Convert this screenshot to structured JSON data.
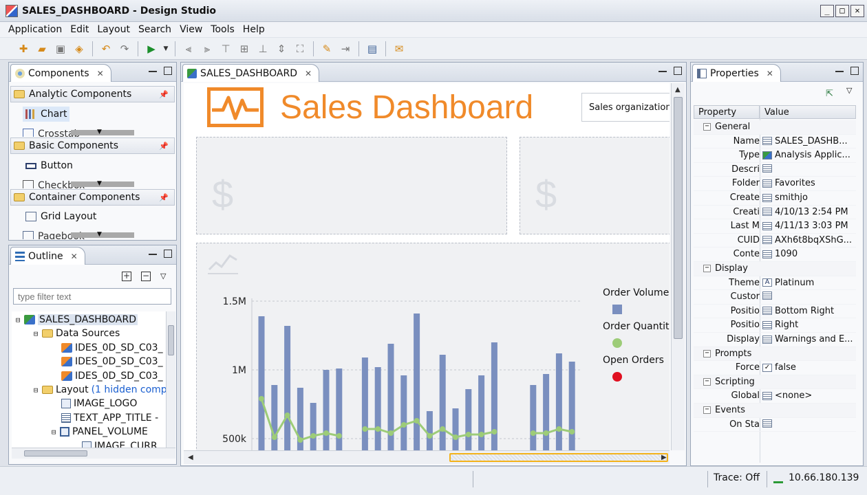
{
  "window": {
    "title": "SALES_DASHBOARD - Design Studio",
    "controls": [
      "_",
      "□",
      "✕"
    ]
  },
  "menu": [
    "Application",
    "Edit",
    "Layout",
    "Search",
    "View",
    "Tools",
    "Help"
  ],
  "components": {
    "tab_label": "Components",
    "sections": [
      {
        "label": "Analytic Components",
        "items": [
          {
            "label": "Chart",
            "selected": true
          }
        ],
        "clipped": "Crosstab"
      },
      {
        "label": "Basic Components",
        "items": [
          {
            "label": "Button"
          }
        ],
        "clipped": "Checkbox"
      },
      {
        "label": "Container Components",
        "items": [
          {
            "label": "Grid Layout"
          }
        ],
        "clipped": "Pagebook"
      }
    ]
  },
  "outline": {
    "tab_label": "Outline",
    "filter_placeholder": "type filter text",
    "tree": {
      "root": "SALES_DASHBOARD",
      "data_sources_label": "Data Sources",
      "data_sources": [
        "IDES_0D_SD_C03_",
        "IDES_0D_SD_C03_",
        "IDES_0D_SD_C03_"
      ],
      "layout_label": "Layout",
      "layout_hidden": "(1 hidden comp",
      "layout_items": [
        "IMAGE_LOGO",
        "TEXT_APP_TITLE -",
        "PANEL_VOLUME",
        "IMAGE_CURR"
      ]
    }
  },
  "editor": {
    "tab_label": "SALES_DASHBOARD",
    "dashboard_title": "Sales Dashboard",
    "sales_org_label": "Sales organization",
    "currency_symbol": "$",
    "legend": [
      {
        "label": "Order Volume",
        "color": "#7a8fbf",
        "shape": "square"
      },
      {
        "label": "Order Quantity",
        "color": "#9dcc78",
        "shape": "circle"
      },
      {
        "label": "Open Orders",
        "color": "#e01020",
        "shape": "circle"
      }
    ]
  },
  "chart_data": {
    "type": "bar",
    "ylim": [
      0,
      1500000
    ],
    "y_ticks": [
      {
        "value": 1500000,
        "label": "1.5M"
      },
      {
        "value": 1000000,
        "label": "1M"
      },
      {
        "value": 500000,
        "label": "500k"
      }
    ],
    "series": [
      {
        "name": "Order Volume",
        "type": "bar",
        "values": [
          1390000,
          890000,
          1320000,
          870000,
          760000,
          1000000,
          1010000,
          null,
          1090000,
          1020000,
          1190000,
          960000,
          1410000,
          700000,
          1110000,
          720000,
          860000,
          960000,
          1200000,
          null,
          null,
          890000,
          970000,
          1120000,
          1060000
        ]
      },
      {
        "name": "Order Quantity",
        "type": "line",
        "values": [
          790000,
          510000,
          670000,
          490000,
          520000,
          540000,
          520000,
          null,
          570000,
          570000,
          540000,
          600000,
          630000,
          520000,
          570000,
          510000,
          530000,
          530000,
          550000,
          null,
          null,
          540000,
          540000,
          570000,
          550000
        ]
      }
    ]
  },
  "properties": {
    "tab_label": "Properties",
    "col_property": "Property",
    "col_value": "Value",
    "rows": [
      {
        "category": "General"
      },
      {
        "name": "Name",
        "value": "SALES_DASHB...",
        "icon": "text-icon"
      },
      {
        "name": "Type",
        "value": "Analysis Applic...",
        "icon": "app-icon"
      },
      {
        "name": "Descri",
        "value": "",
        "icon": "text-icon"
      },
      {
        "name": "Folder",
        "value": "Favorites",
        "icon": "text-icon"
      },
      {
        "name": "Create",
        "value": "smithjo",
        "icon": "text-icon"
      },
      {
        "name": "Creati",
        "value": "4/10/13 2:54 PM",
        "icon": "text-icon"
      },
      {
        "name": "Last M",
        "value": "4/11/13 3:03 PM",
        "icon": "text-icon"
      },
      {
        "name": "CUID",
        "value": "AXh6t8bqXShG...",
        "icon": "text-icon"
      },
      {
        "name": "Conte",
        "value": "1090",
        "icon": "text-icon"
      },
      {
        "category": "Display"
      },
      {
        "name": "Theme",
        "value": "Platinum",
        "icon": "font-icon"
      },
      {
        "name": "Custor",
        "value": "",
        "icon": "text-icon"
      },
      {
        "name": "Positio",
        "value": "Bottom Right",
        "icon": "text-icon"
      },
      {
        "name": "Positio",
        "value": "Right",
        "icon": "text-icon"
      },
      {
        "name": "Display",
        "value": "Warnings and E...",
        "icon": "text-icon"
      },
      {
        "category": "Prompts"
      },
      {
        "name": "Force",
        "value": "false",
        "icon": "bool-icon"
      },
      {
        "category": "Scripting"
      },
      {
        "name": "Global",
        "value": "<none>",
        "icon": "text-icon"
      },
      {
        "category": "Events"
      },
      {
        "name": "On Sta",
        "value": "",
        "icon": "text-icon"
      }
    ]
  },
  "status": {
    "trace": "Trace: Off",
    "ip": "10.66.180.139"
  }
}
